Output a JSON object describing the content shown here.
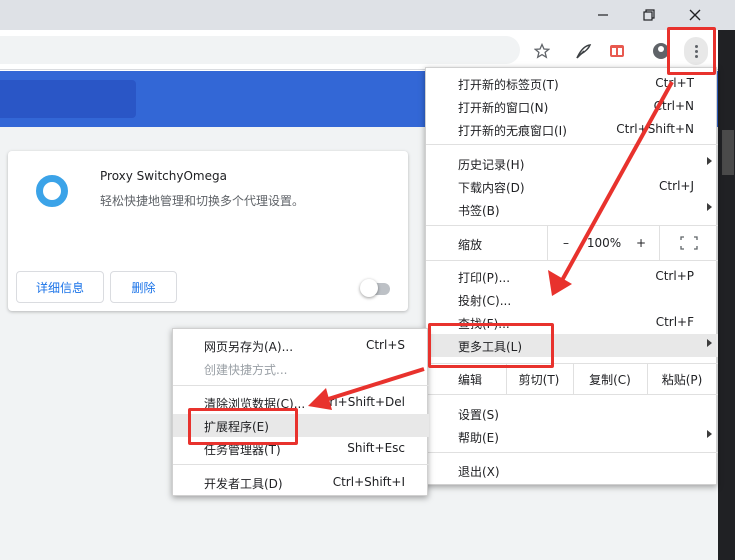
{
  "window": {
    "minimize_icon": "minimize-icon",
    "restore_icon": "restore-icon",
    "close_icon": "close-icon"
  },
  "toolbar": {
    "icons": [
      "star-icon",
      "extension-feather-icon",
      "extension-red-icon",
      "profile-icon",
      "kebab-menu-icon"
    ]
  },
  "extension": {
    "name": "Proxy SwitchyOmega",
    "description": "轻松快捷地管理和切换多个代理设置。",
    "details_button": "详细信息",
    "remove_button": "删除",
    "enabled": false
  },
  "main_menu": {
    "new_tab": {
      "label": "打开新的标签页(T)",
      "shortcut": "Ctrl+T"
    },
    "new_window": {
      "label": "打开新的窗口(N)",
      "shortcut": "Ctrl+N"
    },
    "new_incognito": {
      "label": "打开新的无痕窗口(I)",
      "shortcut": "Ctrl+Shift+N"
    },
    "history": {
      "label": "历史记录(H)"
    },
    "downloads": {
      "label": "下载内容(D)",
      "shortcut": "Ctrl+J"
    },
    "bookmarks": {
      "label": "书签(B)"
    },
    "zoom": {
      "label": "缩放",
      "minus": "–",
      "value": "100%",
      "plus": "+"
    },
    "print": {
      "label": "打印(P)...",
      "shortcut": "Ctrl+P"
    },
    "cast": {
      "label": "投射(C)..."
    },
    "find": {
      "label": "查找(F)...",
      "shortcut": "Ctrl+F"
    },
    "more_tools": {
      "label": "更多工具(L)"
    },
    "edit": {
      "label": "编辑",
      "cut": "剪切(T)",
      "copy": "复制(C)",
      "paste": "粘贴(P)"
    },
    "settings": {
      "label": "设置(S)"
    },
    "help": {
      "label": "帮助(E)"
    },
    "exit": {
      "label": "退出(X)"
    }
  },
  "sub_menu": {
    "save_page": {
      "label": "网页另存为(A)...",
      "shortcut": "Ctrl+S"
    },
    "create_shortcut": {
      "label": "创建快捷方式..."
    },
    "clear_data": {
      "label": "清除浏览数据(C)...",
      "shortcut": "Ctrl+Shift+Del"
    },
    "extensions": {
      "label": "扩展程序(E)"
    },
    "task_manager": {
      "label": "任务管理器(T)",
      "shortcut": "Shift+Esc"
    },
    "devtools": {
      "label": "开发者工具(D)",
      "shortcut": "Ctrl+Shift+I"
    }
  },
  "colors": {
    "accent_blue": "#3367d6",
    "annotation_red": "#e8322d",
    "link_blue": "#1a73e8"
  }
}
